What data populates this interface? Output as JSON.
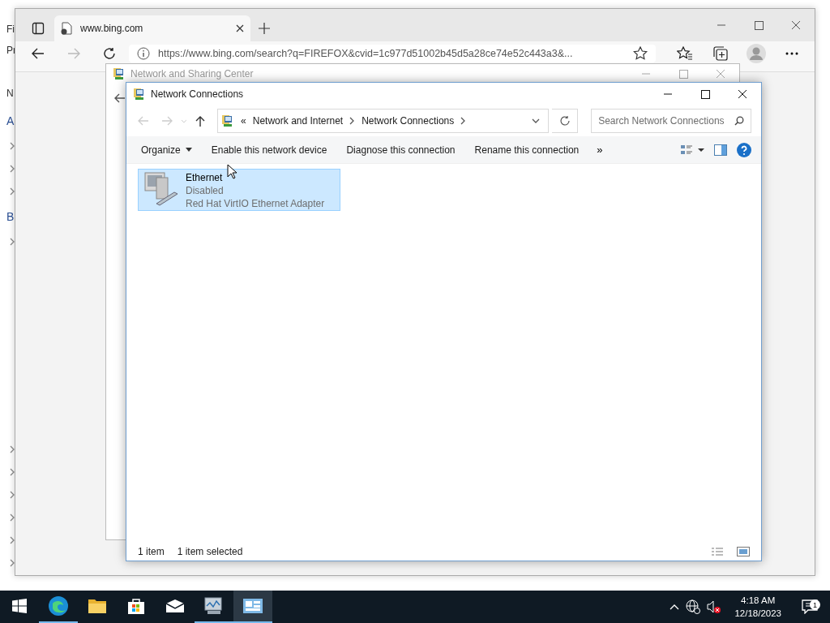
{
  "background_window": {
    "top_rows": [
      {
        "kind": "menu",
        "text": "Fi"
      },
      {
        "kind": "tab",
        "text": "Pr"
      },
      {
        "kind": "header",
        "text": "N"
      },
      {
        "kind": "group",
        "text": "A"
      },
      {
        "kind": "expander"
      },
      {
        "kind": "expander"
      },
      {
        "kind": "expander"
      },
      {
        "kind": "group",
        "text": "B"
      },
      {
        "kind": "expander"
      }
    ],
    "bottom_rows": [
      {
        "kind": "expander"
      },
      {
        "kind": "expander"
      },
      {
        "kind": "expander"
      },
      {
        "kind": "expander"
      },
      {
        "kind": "expander"
      },
      {
        "kind": "expander"
      }
    ]
  },
  "browser": {
    "tabs": [
      {
        "title": "www.bing.com",
        "selected": true
      }
    ],
    "address": "https://www.bing.com/search?q=FIREFOX&cvid=1c977d51002b45d5a28ce74e52c443a3&..."
  },
  "sharing_center": {
    "title": "Network and Sharing Center"
  },
  "explorer": {
    "title": "Network Connections",
    "breadcrumb_overflow": "«",
    "breadcrumb": [
      "Network and Internet",
      "Network Connections"
    ],
    "search": {
      "placeholder": "Search Network Connections"
    },
    "commands": [
      {
        "label": "Organize",
        "dropdown": true
      },
      {
        "label": "Enable this network device",
        "dropdown": false
      },
      {
        "label": "Diagnose this connection",
        "dropdown": false
      },
      {
        "label": "Rename this connection",
        "dropdown": false
      }
    ],
    "more": "»",
    "items": [
      {
        "name": "Ethernet",
        "status": "Disabled",
        "device": "Red Hat VirtIO Ethernet Adapter",
        "selected": true
      }
    ],
    "status_bar": {
      "count": "1 item",
      "selection": "1 item selected"
    }
  },
  "taskbar": {
    "apps": [
      {
        "kind": "edge",
        "running": true,
        "selected": false
      },
      {
        "kind": "folder",
        "running": false,
        "selected": false
      },
      {
        "kind": "store",
        "running": false,
        "selected": false
      },
      {
        "kind": "mail",
        "running": false,
        "selected": false
      },
      {
        "kind": "monitor",
        "running": true,
        "selected": false
      },
      {
        "kind": "network",
        "running": true,
        "selected": true
      }
    ],
    "time": "4:18 AM",
    "date": "12/18/2023",
    "notifications": "1"
  }
}
